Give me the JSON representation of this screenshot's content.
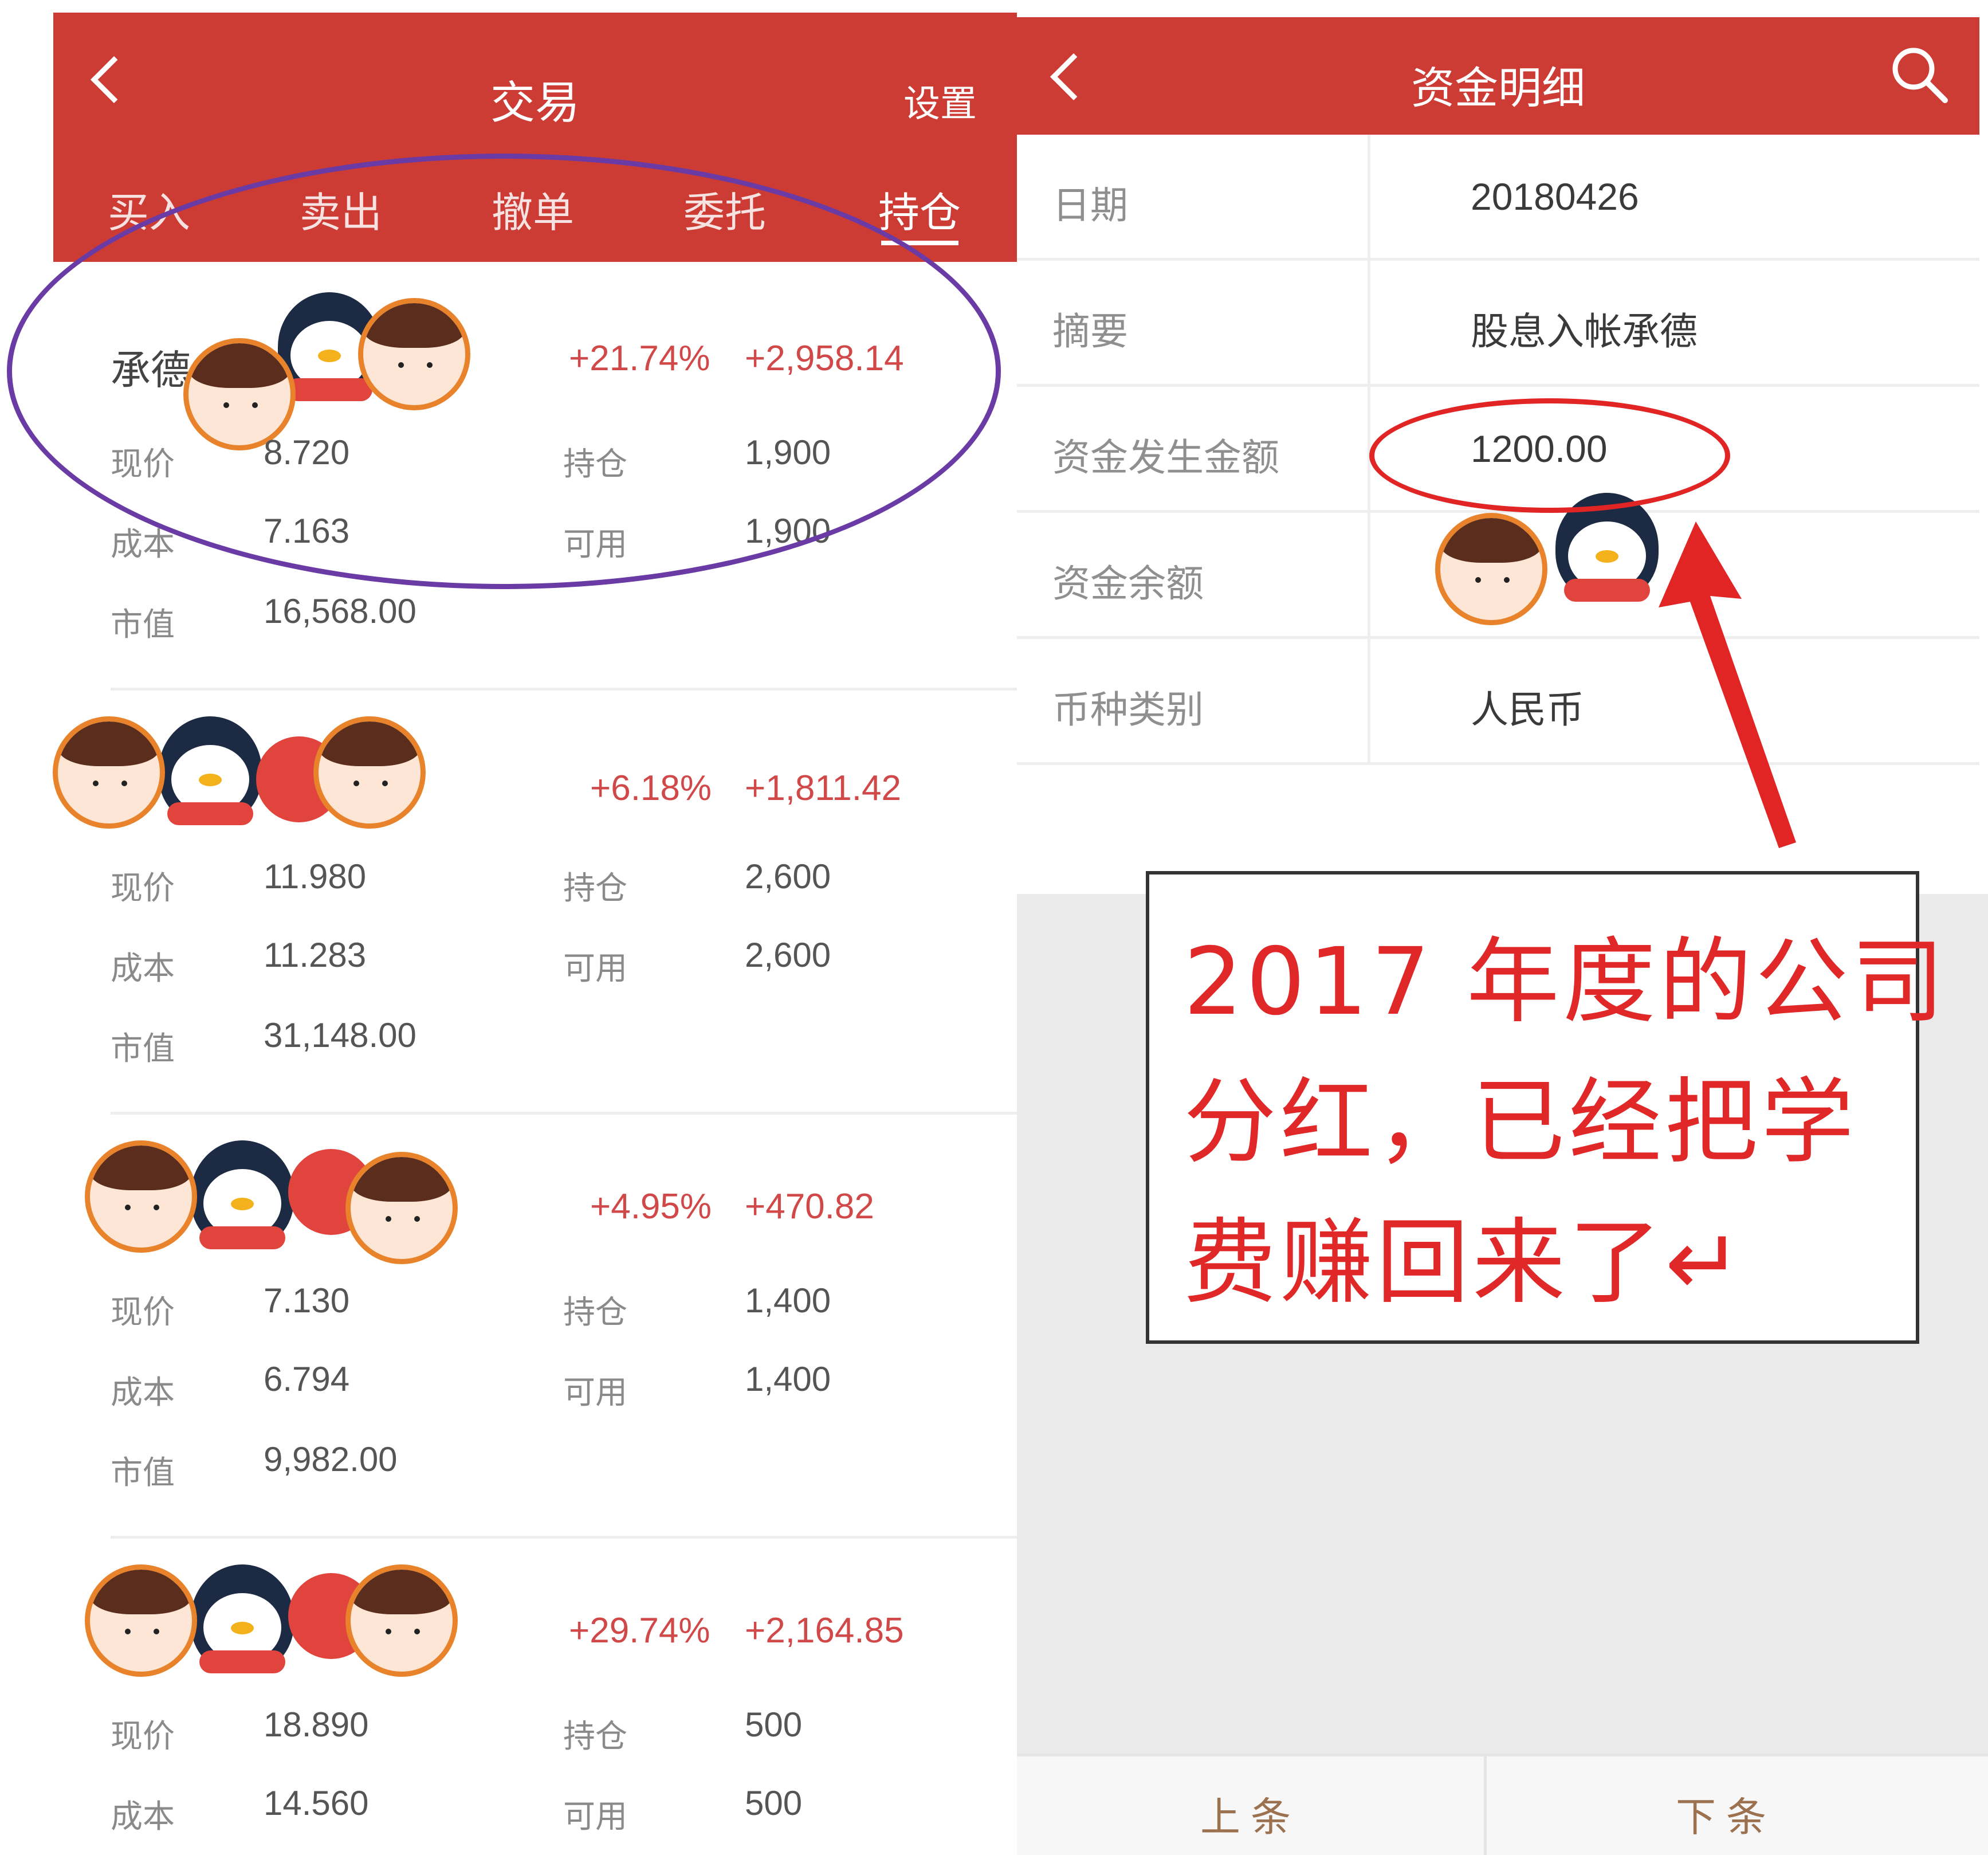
{
  "left": {
    "title": "交易",
    "settings": "设置",
    "tabs": [
      "买入",
      "卖出",
      "撤单",
      "委托",
      "持仓"
    ],
    "active_tab": "持仓",
    "labels": {
      "price": "现价",
      "cost": "成本",
      "market_value": "市值",
      "holding": "持仓",
      "available": "可用"
    },
    "holdings": [
      {
        "name": "承德",
        "pct": "+21.74%",
        "pnl": "+2,958.14",
        "price": "8.720",
        "cost": "7.163",
        "market_value": "16,568.00",
        "holding": "1,900",
        "available": "1,900"
      },
      {
        "name": "",
        "pct": "+6.18%",
        "pnl": "+1,811.42",
        "price": "11.980",
        "cost": "11.283",
        "market_value": "31,148.00",
        "holding": "2,600",
        "available": "2,600"
      },
      {
        "name": "",
        "pct": "+4.95%",
        "pnl": "+470.82",
        "price": "7.130",
        "cost": "6.794",
        "market_value": "9,982.00",
        "holding": "1,400",
        "available": "1,400"
      },
      {
        "name": "",
        "pct": "+29.74%",
        "pnl": "+2,164.85",
        "price": "18.890",
        "cost": "14.560",
        "market_value": "",
        "holding": "500",
        "available": "500"
      }
    ]
  },
  "right": {
    "title": "资金明细",
    "rows": [
      {
        "label": "日期",
        "value": "20180426"
      },
      {
        "label": "摘要",
        "value": "股息入帐承德"
      },
      {
        "label": "资金发生金额",
        "value": "1200.00"
      },
      {
        "label": "资金余额",
        "value": ""
      },
      {
        "label": "币种类别",
        "value": "人民币"
      }
    ],
    "footer": {
      "prev": "上条",
      "next": "下条"
    }
  },
  "annotation": {
    "lines": [
      "2017 年度的公司",
      "分红，已经把学",
      "费赚回来了↵"
    ]
  },
  "colors": {
    "header_red": "#cc3c35",
    "profit_red": "#d04848",
    "circle_purple": "#6a3ba5",
    "annotation_red": "#e02828"
  }
}
